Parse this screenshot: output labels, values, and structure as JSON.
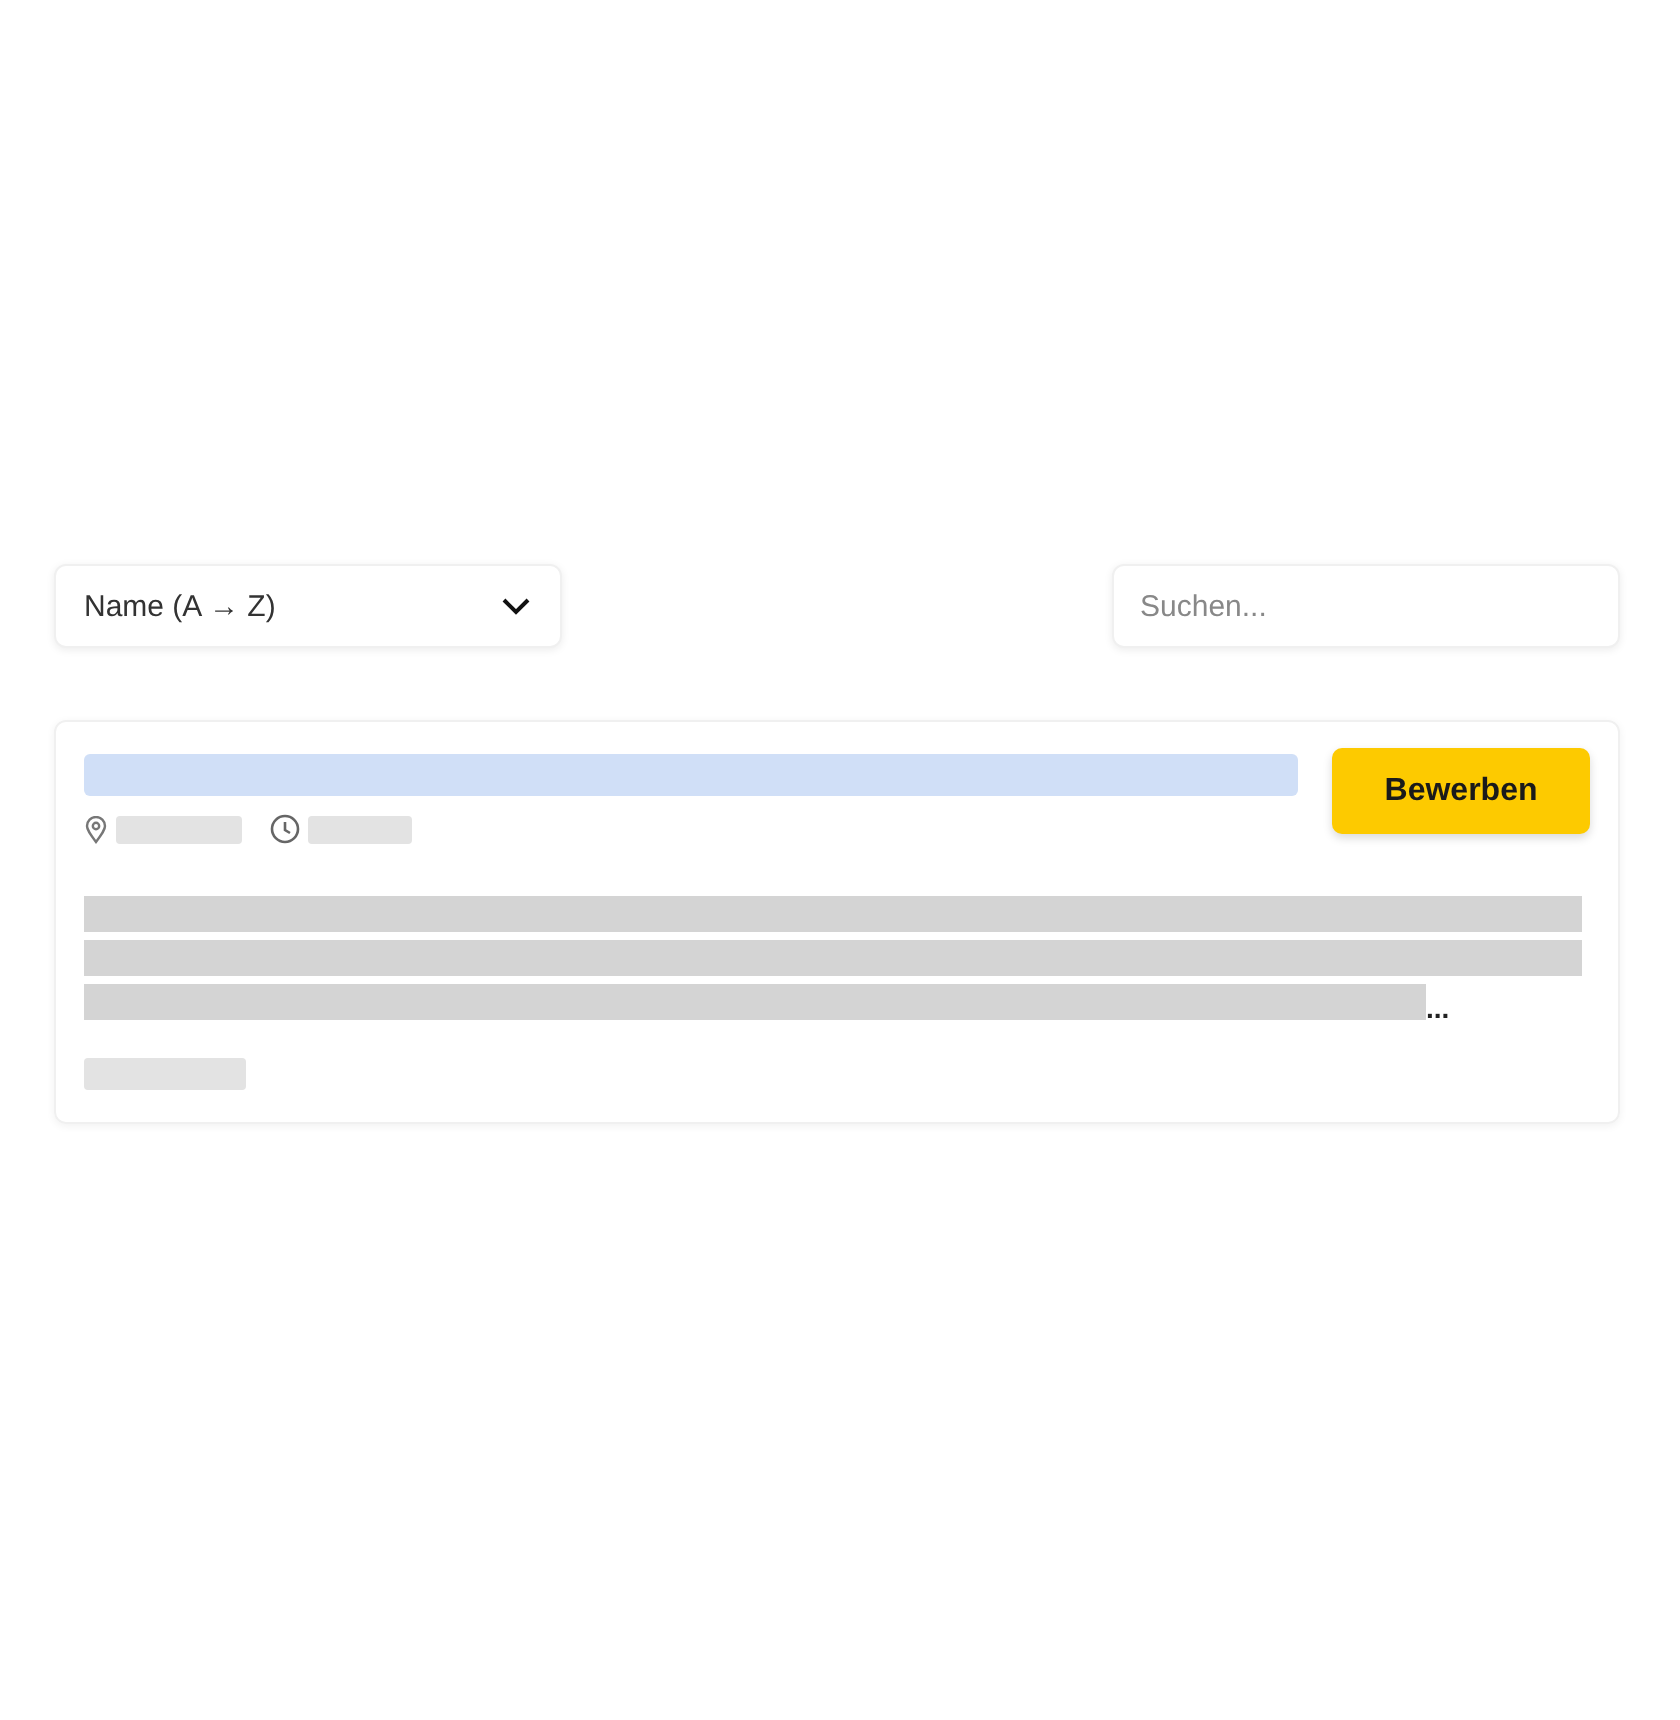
{
  "sort": {
    "value": "Name (A → Z)"
  },
  "search": {
    "placeholder": "Suchen..."
  },
  "card": {
    "apply_button": "Bewerben",
    "ellipsis": "..."
  }
}
